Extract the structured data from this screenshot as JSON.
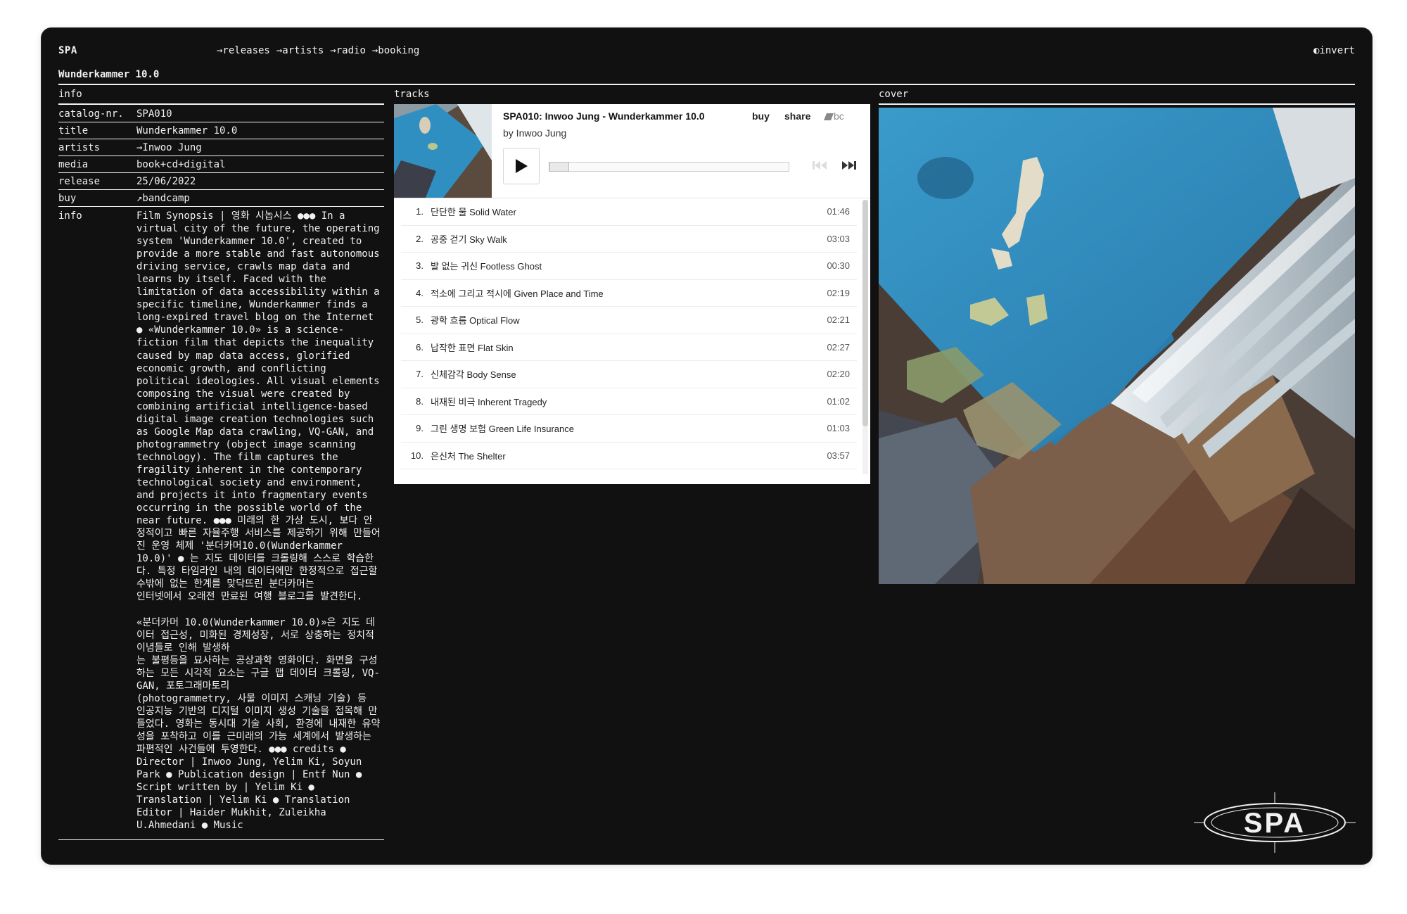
{
  "site": {
    "logo": "SPA",
    "nav": [
      "→releases",
      "→artists",
      "→radio",
      "→booking"
    ],
    "invert": "◐invert",
    "footer_logo": "SPA"
  },
  "release": {
    "heading": "Wunderkammer 10.0",
    "sections": {
      "info": "info",
      "tracks": "tracks",
      "cover": "cover"
    },
    "info": [
      {
        "key": "catalog-nr.",
        "value": "SPA010"
      },
      {
        "key": "title",
        "value": "Wunderkammer 10.0"
      },
      {
        "key": "artists",
        "value": "→Inwoo Jung"
      },
      {
        "key": "media",
        "value": "book+cd+digital"
      },
      {
        "key": "release",
        "value": "25/06/2022"
      },
      {
        "key": "buy",
        "value": "↗bandcamp"
      }
    ],
    "info_label": "info",
    "info_text": "Film Synopsis | 영화 시놉시스 ●●● In a virtual city of the future, the operating system 'Wunderkammer 10.0', created to provide a more stable and fast autonomous driving service, crawls map data and learns by itself. Faced with the limitation of data accessibility within a specific timeline, Wunderkammer finds a long-expired travel blog on the Internet ● «Wunderkammer 10.0» is a science-fiction film that depicts the inequality caused by map data access, glorified economic growth, and conflicting political ideologies. All visual elements composing the visual were created by combining artificial intelligence-based digital image creation technologies such as Google Map data crawling, VQ-GAN, and photogrammetry (object image scanning technology). The film captures the fragility inherent in the contemporary technological society and environment, and projects it into fragmentary events occurring in the possible world of the near future. ●●● 미래의 한 가상 도시, 보다 안정적이고 빠른 자율주행 서비스를 제공하기 위해 만들어진 운영 체제 '분더카머10.0(Wunderkammer 10.0)' ● 는 지도 데이터를 크롤링해 스스로 학습한다. 특정 타임라인 내의 데이터에만 한정적으로 접근할 수밖에 없는 한계를 맞닥뜨린 분더카머는\n인터넷에서 오래전 만료된 여행 블로그를 발견한다.\n\n«분더카머 10.0(Wunderkammer 10.0)»은 지도 데이터 접근성, 미화된 경제성장, 서로 상충하는 정치적 이념들로 인해 발생하\n는 불평등을 묘사하는 공상과학 영화이다. 화면을 구성하는 모든 시각적 요소는 구글 맵 데이터 크롤링, VQ-GAN, 포토그래마토리\n(photogrammetry, 사물 이미지 스캐닝 기술) 등 인공지능 기반의 디지털 이미지 생성 기술을 접목해 만들었다. 영화는 동시대 기술 사회, 환경에 내재한 유약성을 포착하고 이를 근미래의 가능 세계에서 발생하는 파편적인 사건들에 투영한다. ●●● credits ● Director | Inwoo Jung, Yelim Ki, Soyun Park ● Publication design | Entf Nun ● Script written by | Yelim Ki ● Translation | Yelim Ki ● Translation Editor | Haider Mukhit, Zuleikha U.Ahmedani ● Music"
  },
  "player": {
    "title": "SPA010: Inwoo Jung - Wunderkammer 10.0",
    "by": "by Inwoo Jung",
    "buy": "buy",
    "share": "share",
    "bc": "bc",
    "play_icon": "play-icon",
    "prev_icon": "previous-track-icon",
    "next_icon": "next-track-icon",
    "progress": 0,
    "tracks": [
      {
        "num": "1.",
        "title": "단단한 물 Solid Water",
        "duration": "01:46"
      },
      {
        "num": "2.",
        "title": "공중 걷기 Sky Walk",
        "duration": "03:03"
      },
      {
        "num": "3.",
        "title": "발 없는 귀신 Footless Ghost",
        "duration": "00:30"
      },
      {
        "num": "4.",
        "title": "적소에 그리고 적시에 Given Place and Time",
        "duration": "02:19"
      },
      {
        "num": "5.",
        "title": "광학 흐름 Optical Flow",
        "duration": "02:21"
      },
      {
        "num": "6.",
        "title": "납작한 표면 Flat Skin",
        "duration": "02:27"
      },
      {
        "num": "7.",
        "title": "신체감각 Body Sense",
        "duration": "02:20"
      },
      {
        "num": "8.",
        "title": "내재된 비극 Inherent Tragedy",
        "duration": "01:02"
      },
      {
        "num": "9.",
        "title": "그린 생명 보험 Green Life Insurance",
        "duration": "01:03"
      },
      {
        "num": "10.",
        "title": "은신처 The Shelter",
        "duration": "03:57"
      }
    ]
  },
  "colors": {
    "screen_bg": "#111111",
    "text": "#f1f1f1",
    "player_bg": "#ffffff",
    "cover_blue": "#2f8fc0"
  }
}
